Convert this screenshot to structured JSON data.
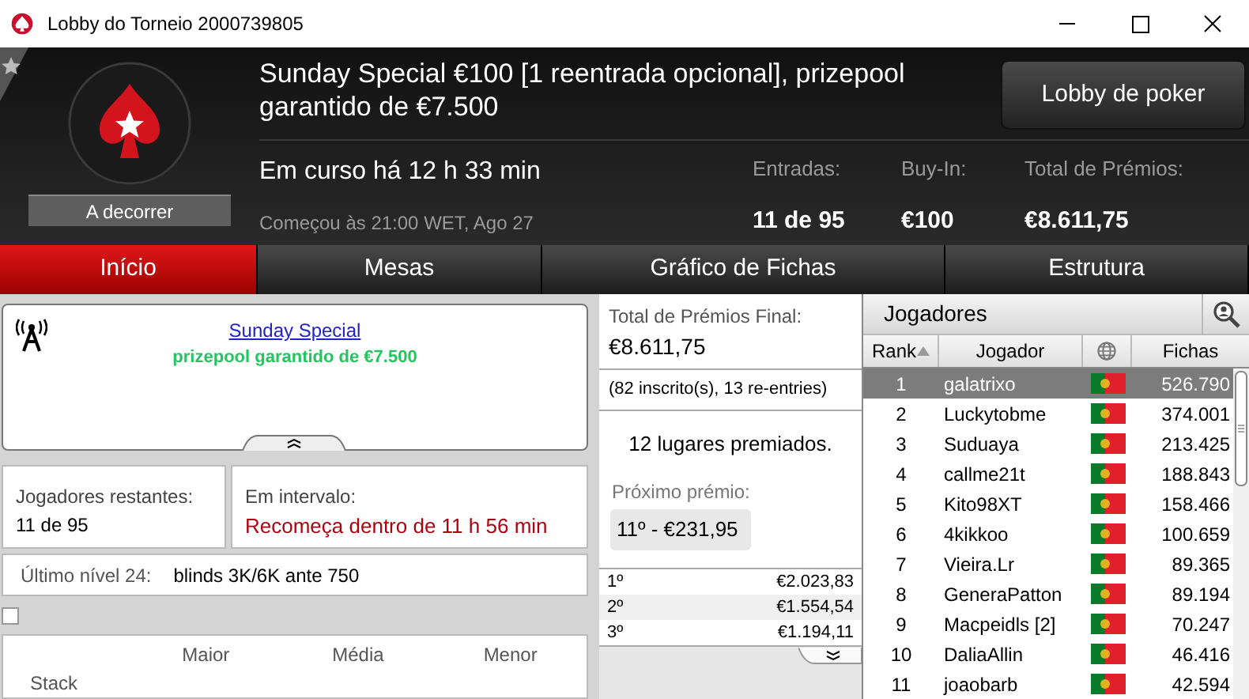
{
  "window": {
    "title": "Lobby do Torneio 2000739805"
  },
  "header": {
    "status_badge": "A decorrer",
    "tournament_name": "Sunday Special €100 [1 reentrada opcional], prizepool garantido de €7.500",
    "running_time": "Em curso há 12 h 33 min",
    "start_time": "Começou às 21:00 WET, Ago 27",
    "lobby_button": "Lobby de poker",
    "stats": [
      {
        "label": "Entradas:",
        "value": "11 de 95"
      },
      {
        "label": "Buy-In:",
        "value": "€100"
      },
      {
        "label": "Total de Prémios:",
        "value": "€8.611,75"
      }
    ]
  },
  "tabs": [
    {
      "label": "Início",
      "selected": true
    },
    {
      "label": "Mesas",
      "selected": false
    },
    {
      "label": "Gráfico de Fichas",
      "selected": false
    },
    {
      "label": "Estrutura",
      "selected": false
    }
  ],
  "announcement": {
    "link": "Sunday Special",
    "subtitle": "prizepool garantido de €7.500"
  },
  "players_remaining": {
    "label": "Jogadores restantes:",
    "value": "11 de 95"
  },
  "break_info": {
    "label": "Em intervalo:",
    "value": "Recomeça dentro de 11 h 56 min"
  },
  "last_level": {
    "label": "Último nível 24:",
    "value": "blinds 3K/6K ante 750"
  },
  "stack_checkbox": {
    "checked": false
  },
  "stack_table": {
    "columns": [
      "Maior",
      "Média",
      "Menor"
    ],
    "row_label": "Stack"
  },
  "prize_pool": {
    "label": "Total de Prémios Final:",
    "value": "€8.611,75",
    "entries_note": "(82 inscrito(s), 13 re-entries)",
    "places_paid": "12 lugares premiados.",
    "next_prize_label": "Próximo prémio:",
    "next_prize": "11º - €231,95",
    "payouts": [
      {
        "place": "1º",
        "amount": "€2.023,83"
      },
      {
        "place": "2º",
        "amount": "€1.554,54"
      },
      {
        "place": "3º",
        "amount": "€1.194,11"
      }
    ]
  },
  "players": {
    "title": "Jogadores",
    "columns": [
      "Rank",
      "Jogador",
      "Fichas"
    ],
    "rows": [
      {
        "rank": "1",
        "name": "galatrixo",
        "chips": "526.790",
        "selected": true
      },
      {
        "rank": "2",
        "name": "Luckytobme",
        "chips": "374.001",
        "selected": false
      },
      {
        "rank": "3",
        "name": "Suduaya",
        "chips": "213.425",
        "selected": false
      },
      {
        "rank": "4",
        "name": "callme21t",
        "chips": "188.843",
        "selected": false
      },
      {
        "rank": "5",
        "name": "Kito98XT",
        "chips": "158.466",
        "selected": false
      },
      {
        "rank": "6",
        "name": "4kikkoo",
        "chips": "100.659",
        "selected": false
      },
      {
        "rank": "7",
        "name": "Vieira.Lr",
        "chips": "89.365",
        "selected": false
      },
      {
        "rank": "8",
        "name": "GeneraPatton",
        "chips": "89.194",
        "selected": false
      },
      {
        "rank": "9",
        "name": "Macpeidls [2]",
        "chips": "70.247",
        "selected": false
      },
      {
        "rank": "10",
        "name": "DaliaAllin",
        "chips": "46.416",
        "selected": false
      },
      {
        "rank": "11",
        "name": "joaobarb",
        "chips": "42.594",
        "selected": false
      }
    ]
  }
}
